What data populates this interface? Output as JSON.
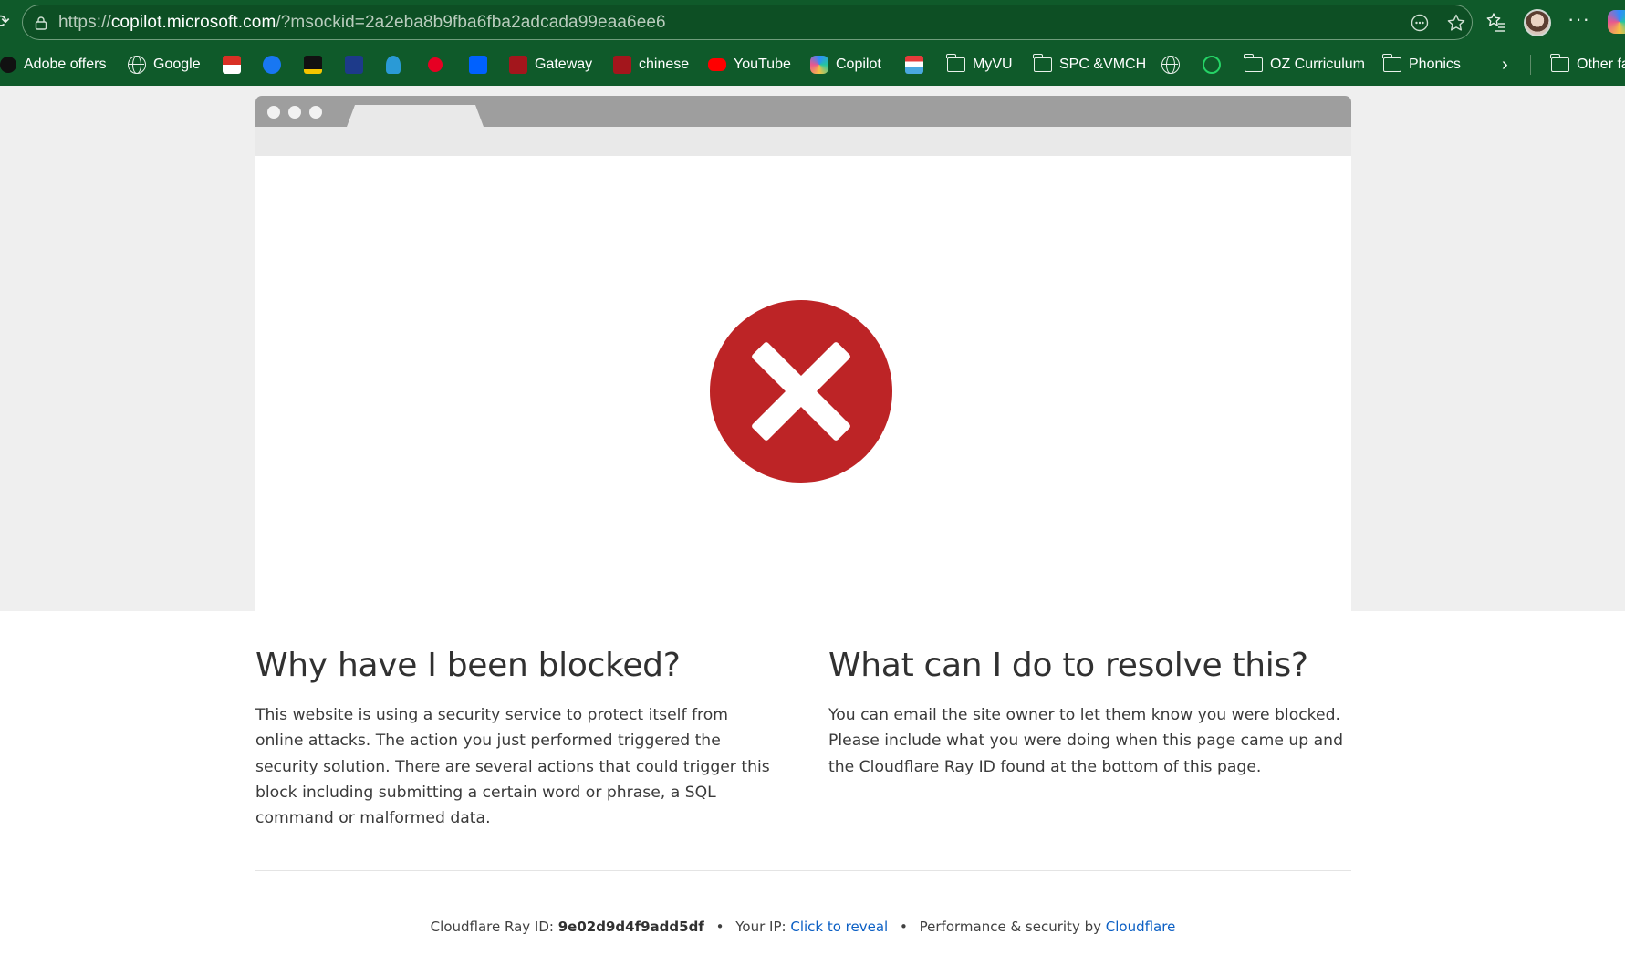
{
  "browser": {
    "url_prefix": "https://",
    "url_host": "copilot.microsoft.com",
    "url_path": "/?msockid=2a2eba8b9fba6fba2adcada99eaa6ee6",
    "more_label": "···"
  },
  "bookmarks": [
    {
      "label": "Adobe offers",
      "icon": "hp-icon"
    },
    {
      "label": "Google",
      "icon": "globe-icon"
    },
    {
      "label": "",
      "icon": "gmail-100-icon"
    },
    {
      "label": "",
      "icon": "facebook-icon"
    },
    {
      "label": "",
      "icon": "a-logo-icon"
    },
    {
      "label": "",
      "icon": "bookmark-blue-icon"
    },
    {
      "label": "",
      "icon": "tree-icon"
    },
    {
      "label": "",
      "icon": "pinterest-icon"
    },
    {
      "label": "",
      "icon": "dropbox-icon"
    },
    {
      "label": "Gateway",
      "icon": "gateway-icon"
    },
    {
      "label": "chinese",
      "icon": "chinese-icon"
    },
    {
      "label": "YouTube",
      "icon": "youtube-icon"
    },
    {
      "label": "Copilot",
      "icon": "copilot-icon"
    },
    {
      "label": "",
      "icon": "flag-icon"
    },
    {
      "label": "MyVU",
      "icon": "folder-icon"
    },
    {
      "label": "SPC &VMCH",
      "icon": "folder-icon"
    },
    {
      "label": "",
      "icon": "globe-icon"
    },
    {
      "label": "",
      "icon": "whatsapp-icon"
    },
    {
      "label": "OZ Curriculum",
      "icon": "folder-icon"
    },
    {
      "label": "Phonics",
      "icon": "folder-icon"
    },
    {
      "label": "Other fa",
      "icon": "folder-icon"
    }
  ],
  "page": {
    "why_heading": "Why have I been blocked?",
    "why_text": "This website is using a security service to protect itself from online attacks. The action you just performed triggered the security solution. There are several actions that could trigger this block including submitting a certain word or phrase, a SQL command or malformed data.",
    "resolve_heading": "What can I do to resolve this?",
    "resolve_text": "You can email the site owner to let them know you were blocked. Please include what you were doing when this page came up and the Cloudflare Ray ID found at the bottom of this page."
  },
  "footer": {
    "ray_label": "Cloudflare Ray ID:",
    "ray_id": "9e02d9d4f9add5df",
    "bullet": "•",
    "ip_label": "Your IP:",
    "ip_link": "Click to reveal",
    "perf_label": "Performance & security by",
    "cloudflare_link": "Cloudflare"
  },
  "colors": {
    "chrome_bg": "#0f5a2a",
    "error_red": "#bd2426",
    "link_blue": "#0b5fc4"
  }
}
